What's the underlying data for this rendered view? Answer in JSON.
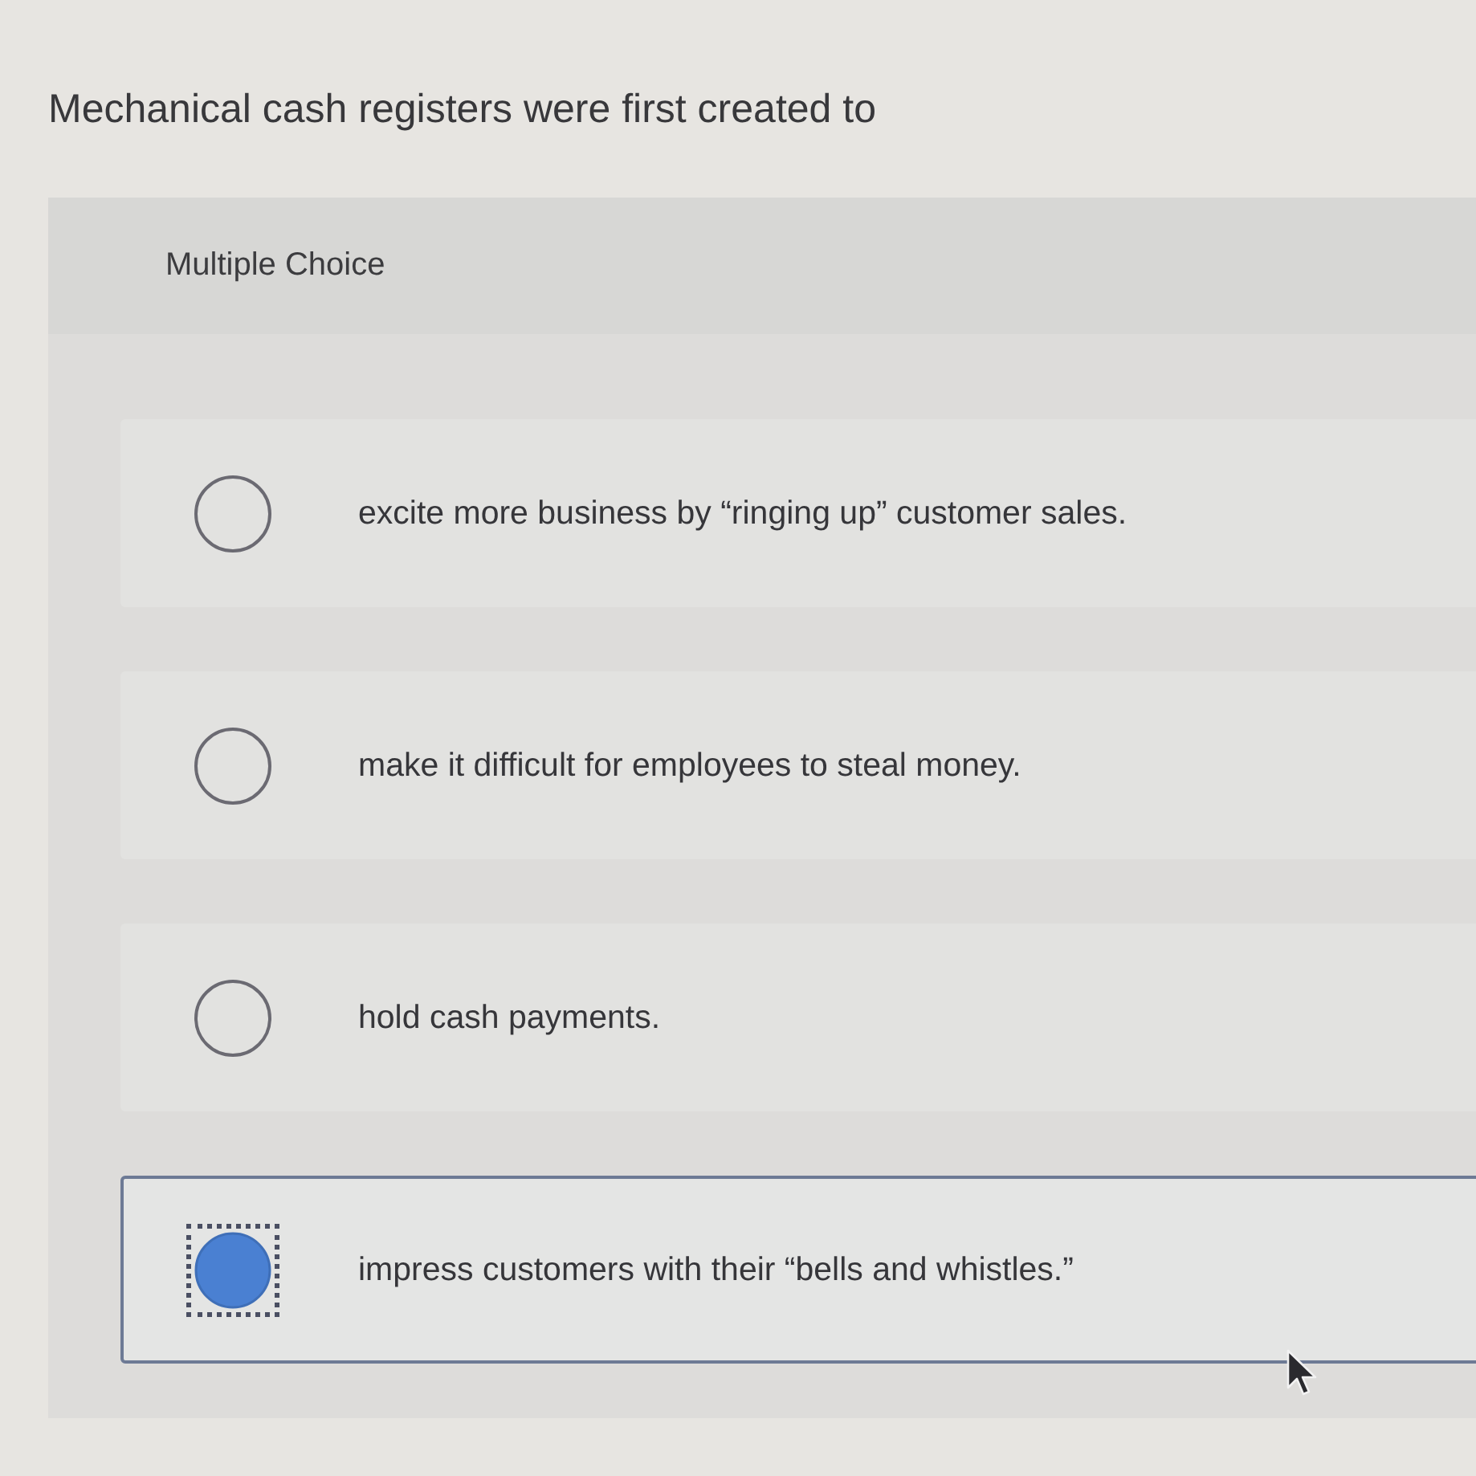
{
  "question": "Mechanical cash registers were first created to",
  "panel": {
    "heading": "Multiple Choice"
  },
  "options": [
    {
      "label": "excite more business by “ringing up” customer sales.",
      "selected": false
    },
    {
      "label": "make it difficult for employees to steal money.",
      "selected": false
    },
    {
      "label": "hold cash payments.",
      "selected": false
    },
    {
      "label": "impress customers with their “bells and whistles.”",
      "selected": true
    }
  ]
}
